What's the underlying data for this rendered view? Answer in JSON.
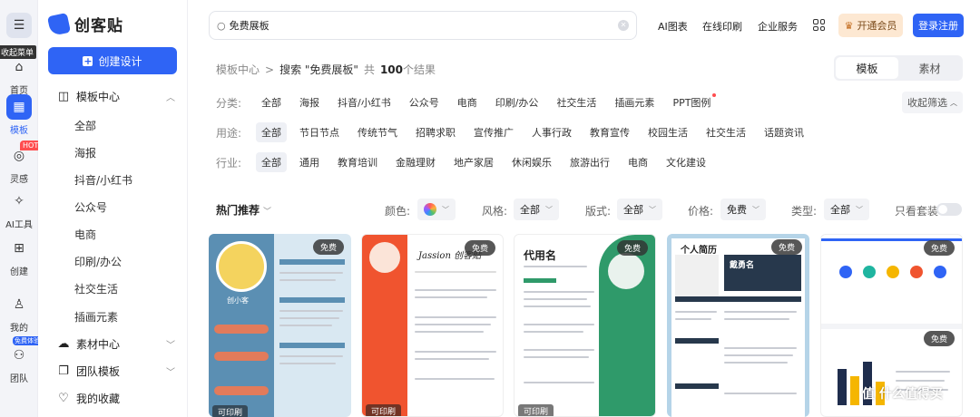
{
  "rail": {
    "menu_tooltip": "收起菜单",
    "items": [
      {
        "label": "首页",
        "icon": "home-icon"
      },
      {
        "label": "模板",
        "icon": "template-icon"
      },
      {
        "label": "灵感",
        "icon": "bulb-icon",
        "badge": "HOT"
      },
      {
        "label": "AI工具",
        "icon": "sparkle-icon"
      },
      {
        "label": "创建",
        "icon": "plus-square-icon"
      },
      {
        "label": "我的",
        "icon": "user-icon"
      },
      {
        "label": "团队",
        "icon": "team-icon",
        "badge": "免费体验"
      }
    ]
  },
  "nav": {
    "logo": "创客贴",
    "create_label": "创建设计",
    "template_center": "模板中心",
    "sub_items": [
      "全部",
      "海报",
      "抖音/小红书",
      "公众号",
      "电商",
      "印刷/办公",
      "社交生活",
      "插画元素"
    ],
    "material_center": "素材中心",
    "team_templates": "团队模板",
    "favorites": "我的收藏"
  },
  "header": {
    "search_value": "免费展板",
    "links": [
      "AI图表",
      "在线印刷",
      "企业服务"
    ],
    "vip_label": "开通会员",
    "login_label": "登录注册"
  },
  "breadcrumb": {
    "root": "模板中心",
    "separator": ">",
    "search_prefix": "搜索 \"免费展板\"",
    "count_prefix": "共",
    "count": "100",
    "count_suffix": "个结果"
  },
  "segment": {
    "options": [
      "模板",
      "素材"
    ],
    "selected": "模板"
  },
  "filters": {
    "category": {
      "label": "分类:",
      "options": [
        "全部",
        "海报",
        "抖音/小红书",
        "公众号",
        "电商",
        "印刷/办公",
        "社交生活",
        "插画元素",
        "PPT图例"
      ]
    },
    "usage": {
      "label": "用途:",
      "options": [
        "全部",
        "节日节点",
        "传统节气",
        "招聘求职",
        "宣传推广",
        "人事行政",
        "教育宣传",
        "校园生活",
        "社交生活",
        "话题资讯"
      ]
    },
    "industry": {
      "label": "行业:",
      "options": [
        "全部",
        "通用",
        "教育培训",
        "金融理财",
        "地产家居",
        "休闲娱乐",
        "旅游出行",
        "电商",
        "文化建设"
      ]
    },
    "collapse_label": "收起筛选"
  },
  "sortbar": {
    "hot_label": "热门推荐",
    "color_label": "颜色:",
    "style_label": "风格:",
    "style_value": "全部",
    "format_label": "版式:",
    "format_value": "全部",
    "price_label": "价格:",
    "price_value": "免费",
    "type_label": "类型:",
    "type_value": "全部",
    "suite_label": "只看套装"
  },
  "cards": [
    {
      "badge": "免费",
      "print": "可印刷",
      "name": "创小客",
      "accent": "#5b8fb3"
    },
    {
      "badge": "免费",
      "print": "可印刷",
      "name": "Jassion 创客贴",
      "accent": "#f0542f"
    },
    {
      "badge": "免费",
      "print": "可印刷",
      "name": "代用名",
      "accent": "#2f9a6a"
    },
    {
      "badge": "免费",
      "name": "个人简历",
      "accent": "#27384c",
      "name2": "戴勇名"
    },
    {
      "badge": "免费",
      "badge2": "免费",
      "accent": "#2f64f5"
    }
  ],
  "watermark": "值 什么值得买"
}
